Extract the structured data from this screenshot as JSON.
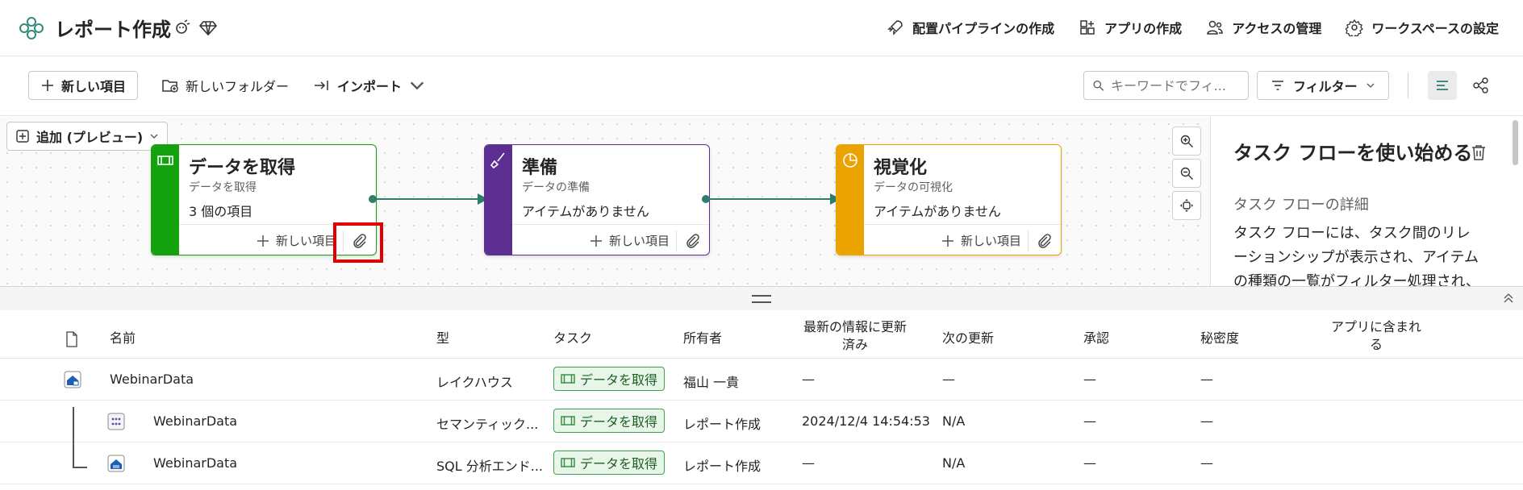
{
  "workspace": {
    "title": "レポート作成",
    "actions": [
      {
        "label": "配置パイプラインの作成",
        "icon": "rocket-icon"
      },
      {
        "label": "アプリの作成",
        "icon": "app-icon"
      },
      {
        "label": "アクセスの管理",
        "icon": "people-icon"
      },
      {
        "label": "ワークスペースの設定",
        "icon": "gear-icon"
      }
    ]
  },
  "toolbar": {
    "new_item": "新しい項目",
    "new_folder": "新しいフォルダー",
    "import": "インポート",
    "search_placeholder": "キーワードでフィ...",
    "filter": "フィルター"
  },
  "canvas": {
    "add_label": "追加 (プレビュー)",
    "cards": [
      {
        "title": "データを取得",
        "subtitle": "データを取得",
        "count": "3 個の項目",
        "new_item": "新しい項目",
        "color": "#13a10e",
        "icon": "pipeline-icon"
      },
      {
        "title": "準備",
        "subtitle": "データの準備",
        "count": "アイテムがありません",
        "new_item": "新しい項目",
        "color": "#5c2e91",
        "icon": "brush-icon"
      },
      {
        "title": "視覚化",
        "subtitle": "データの可視化",
        "count": "アイテムがありません",
        "new_item": "新しい項目",
        "color": "#eaa300",
        "icon": "pie-chart-icon"
      }
    ]
  },
  "panel": {
    "title": "タスク フローを使い始める",
    "subtitle": "タスク フローの詳細",
    "body": "タスク フローには、タスク間のリレーションシップが表示され、アイテムの種類の一覧がフィルター処理され、作"
  },
  "table": {
    "headers": {
      "name": "名前",
      "type": "型",
      "task": "タスク",
      "owner": "所有者",
      "refreshed": "最新の情報に更新済み",
      "next": "次の更新",
      "endorsement": "承認",
      "sensitivity": "秘密度",
      "in_app": "アプリに含まれる"
    },
    "rows": [
      {
        "name": "WebinarData",
        "type": "レイクハウス",
        "task": "データを取得",
        "owner": "福山 一貴",
        "refreshed": "—",
        "next": "—",
        "endorsement": "—",
        "sensitivity": "—"
      },
      {
        "name": "WebinarData",
        "type": "セマンティック...",
        "task": "データを取得",
        "owner": "レポート作成",
        "refreshed": "2024/12/4 14:54:53",
        "next": "N/A",
        "endorsement": "—",
        "sensitivity": "—"
      },
      {
        "name": "WebinarData",
        "type": "SQL 分析エンド...",
        "task": "データを取得",
        "owner": "レポート作成",
        "refreshed": "—",
        "next": "N/A",
        "endorsement": "—",
        "sensitivity": "—"
      }
    ]
  }
}
